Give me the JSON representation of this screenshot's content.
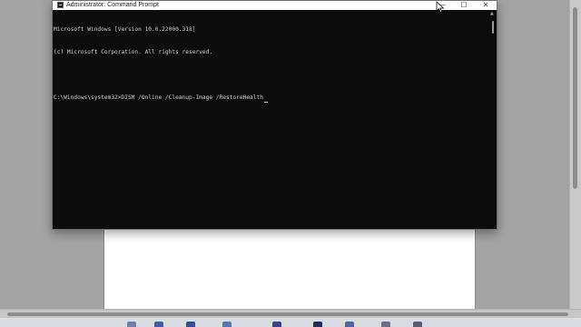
{
  "window": {
    "title": "Administrator: Command Prompt",
    "minimize_label": "—",
    "maximize_label": "☐",
    "close_label": "✕"
  },
  "console": {
    "lines": [
      "Microsoft Windows [Version 10.0.22000.318]",
      "(c) Microsoft Corporation. All rights reserved.",
      "",
      "C:\\Windows\\system32>DISM /Online /Cleanup-Image /RestoreHealth"
    ]
  },
  "colors": {
    "console_bg": "#0c0c0c",
    "console_text": "#cccccc",
    "titlebar_bg": "#ffffff"
  },
  "icons": {
    "app": "command-prompt-icon",
    "pointer": "mouse-pointer-icon"
  }
}
